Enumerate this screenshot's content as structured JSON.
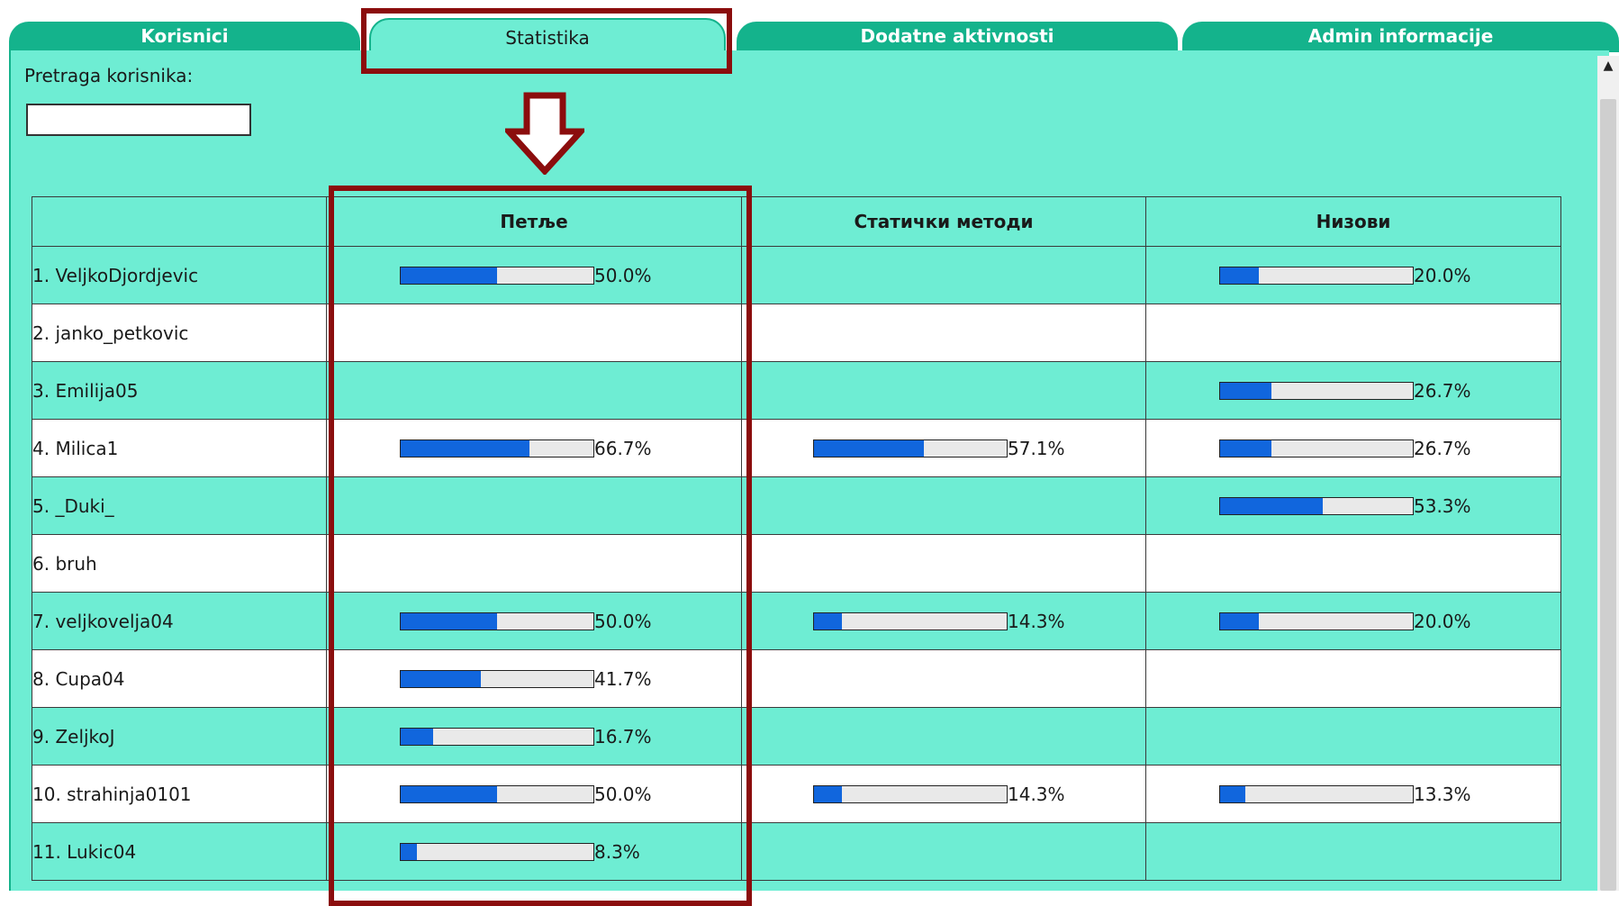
{
  "tabs": [
    {
      "label": "Korisnici"
    },
    {
      "label": "Statistika"
    },
    {
      "label": "Dodatne aktivnosti"
    },
    {
      "label": "Admin informacije"
    }
  ],
  "search": {
    "label": "Pretraga korisnika:",
    "value": ""
  },
  "table": {
    "headers": [
      "",
      "Петље",
      "Статички методи",
      "Низови"
    ],
    "rows": [
      {
        "name": "1. VeljkoDjordjevic",
        "cells": [
          {
            "pct": 50.0,
            "label": "50.0%"
          },
          null,
          {
            "pct": 20.0,
            "label": "20.0%"
          }
        ]
      },
      {
        "name": "2. janko_petkovic",
        "cells": [
          null,
          null,
          null
        ]
      },
      {
        "name": "3. Emilija05",
        "cells": [
          null,
          null,
          {
            "pct": 26.7,
            "label": "26.7%"
          }
        ]
      },
      {
        "name": "4. Milica1",
        "cells": [
          {
            "pct": 66.7,
            "label": "66.7%"
          },
          {
            "pct": 57.1,
            "label": "57.1%"
          },
          {
            "pct": 26.7,
            "label": "26.7%"
          }
        ]
      },
      {
        "name": "5. _Duki_",
        "cells": [
          null,
          null,
          {
            "pct": 53.3,
            "label": "53.3%"
          }
        ]
      },
      {
        "name": "6. bruh",
        "cells": [
          null,
          null,
          null
        ]
      },
      {
        "name": "7. veljkovelja04",
        "cells": [
          {
            "pct": 50.0,
            "label": "50.0%"
          },
          {
            "pct": 14.3,
            "label": "14.3%"
          },
          {
            "pct": 20.0,
            "label": "20.0%"
          }
        ]
      },
      {
        "name": "8. Cupa04",
        "cells": [
          {
            "pct": 41.7,
            "label": "41.7%"
          },
          null,
          null
        ]
      },
      {
        "name": "9. ZeljkoJ",
        "cells": [
          {
            "pct": 16.7,
            "label": "16.7%"
          },
          null,
          null
        ]
      },
      {
        "name": "10. strahinja0101",
        "cells": [
          {
            "pct": 50.0,
            "label": "50.0%"
          },
          {
            "pct": 14.3,
            "label": "14.3%"
          },
          {
            "pct": 13.3,
            "label": "13.3%"
          }
        ]
      },
      {
        "name": "11. Lukic04",
        "cells": [
          {
            "pct": 8.3,
            "label": "8.3%"
          },
          null,
          null
        ]
      }
    ]
  },
  "colors": {
    "panel_bg": "#6eedd3",
    "tab_bg": "#14b38c",
    "bar_fill": "#1166dd",
    "bar_track": "#e9e9e9",
    "highlight": "#8b0d0d"
  },
  "icons": {
    "arrow": "down-arrow-icon",
    "scroll_up": "scroll-up-icon"
  }
}
